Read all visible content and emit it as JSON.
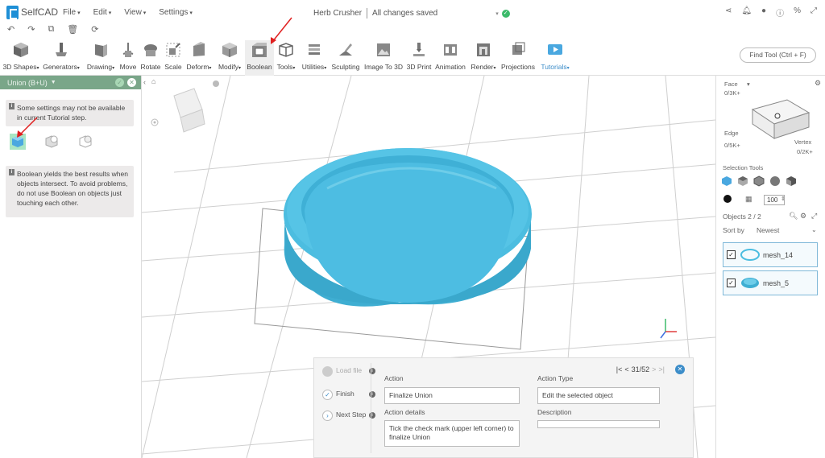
{
  "app": {
    "name": "SelfCAD"
  },
  "menu": [
    {
      "label": "File"
    },
    {
      "label": "Edit"
    },
    {
      "label": "View"
    },
    {
      "label": "Settings"
    }
  ],
  "document": {
    "title": "Herb Crusher",
    "status": "All changes saved"
  },
  "toolbar": {
    "find_tool": "Find Tool (Ctrl + F)",
    "tools": [
      {
        "label": "3D Shapes"
      },
      {
        "label": "Generators"
      },
      {
        "label": "Drawing"
      },
      {
        "label": "Move"
      },
      {
        "label": "Rotate"
      },
      {
        "label": "Scale"
      },
      {
        "label": "Deform"
      },
      {
        "label": "Modify"
      },
      {
        "label": "Boolean"
      },
      {
        "label": "Tools"
      },
      {
        "label": "Utilities"
      },
      {
        "label": "Sculpting"
      },
      {
        "label": "Image To 3D"
      },
      {
        "label": "3D Print"
      },
      {
        "label": "Animation"
      },
      {
        "label": "Render"
      },
      {
        "label": "Projections"
      },
      {
        "label": "Tutorials"
      }
    ]
  },
  "left_panel": {
    "title": "Union (B+U)",
    "notice": "Some settings may not be available in current Tutorial step.",
    "hint": "Boolean yields the best results when objects intersect. To avoid problems, do not use Boolean on objects just touching each other."
  },
  "right_panel": {
    "face_label": "Face",
    "face_count": "0/3K+",
    "edge_label": "Edge",
    "edge_count": "0/5K+",
    "vertex_label": "Vertex",
    "vertex_count": "0/2K+",
    "selection_tools": "Selection Tools",
    "value": "100",
    "objects_label": "Objects 2 / 2",
    "sort_label": "Sort by",
    "sort_value": "Newest",
    "objects": [
      {
        "name": "mesh_14"
      },
      {
        "name": "mesh_5"
      }
    ]
  },
  "tutorial": {
    "steps": [
      {
        "label": "Load file"
      },
      {
        "label": "Finish"
      },
      {
        "label": "Next Step"
      }
    ],
    "progress": "31/52",
    "action_label": "Action",
    "action": "Finalize Union",
    "details_label": "Action details",
    "details": "Tick the check mark (upper left corner) to finalize Union",
    "type_label": "Action Type",
    "type": "Edit the selected object",
    "description_label": "Description",
    "description": ""
  },
  "colors": {
    "accent": "#3c8dc9",
    "panel_header": "#7aa689",
    "mesh": "#4cbde0",
    "highlight": "#a9e6c3"
  }
}
